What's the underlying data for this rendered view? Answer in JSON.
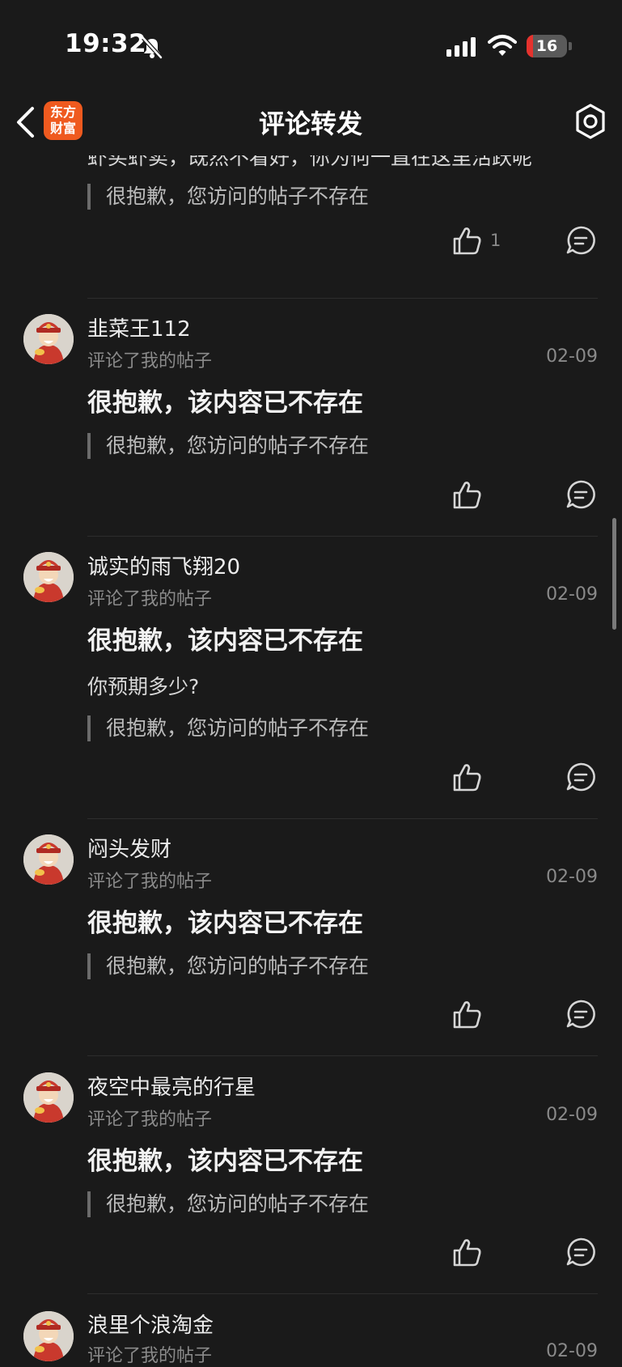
{
  "status_bar": {
    "time": "19:32",
    "battery_level": "16",
    "icons": [
      "bell-slash-icon",
      "cellular-signal-icon",
      "wifi-icon",
      "battery-icon"
    ]
  },
  "nav": {
    "title": "评论转发",
    "logo_line1": "东方",
    "logo_line2": "财富",
    "icons": [
      "chevron-left-icon",
      "gear-icon"
    ]
  },
  "colors": {
    "background": "#1a1a1a",
    "logo": "#ef5a1f",
    "battery_low": "#e5322d"
  },
  "top_partial": {
    "reply_text": "虾买虾卖，既然不看好，你为何一直在这里活跃呢",
    "quote": "很抱歉，您访问的帖子不存在",
    "like_count": "1"
  },
  "comments": [
    {
      "username": "韭菜王112",
      "action": "评论了我的帖子",
      "date": "02-09",
      "main": "很抱歉，该内容已不存在",
      "quote": "很抱歉，您访问的帖子不存在"
    },
    {
      "username": "诚实的雨飞翔20",
      "action": "评论了我的帖子",
      "date": "02-09",
      "main": "很抱歉，该内容已不存在",
      "reply": "你预期多少?",
      "quote": "很抱歉，您访问的帖子不存在"
    },
    {
      "username": "闷头发财",
      "action": "评论了我的帖子",
      "date": "02-09",
      "main": "很抱歉，该内容已不存在",
      "quote": "很抱歉，您访问的帖子不存在"
    },
    {
      "username": "夜空中最亮的行星",
      "action": "评论了我的帖子",
      "date": "02-09",
      "main": "很抱歉，该内容已不存在",
      "quote": "很抱歉，您访问的帖子不存在"
    },
    {
      "username": "浪里个浪淘金",
      "action": "评论了我的帖子",
      "date": "02-09"
    }
  ]
}
